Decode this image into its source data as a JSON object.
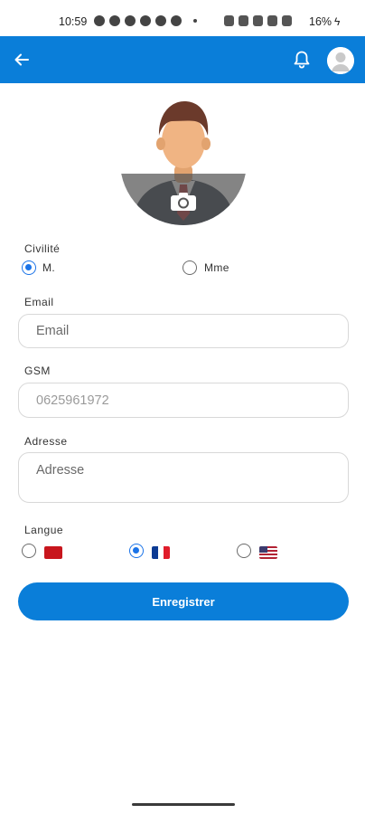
{
  "status_bar": {
    "time": "10:59",
    "battery": "16%",
    "charging_glyph": "ϟ"
  },
  "app_bar": {
    "background_color": "#0a7ed9",
    "back_icon": "arrow-left-icon",
    "notification_icon": "bell-icon",
    "profile_icon": "user-avatar-icon"
  },
  "avatar": {
    "icon": "person-avatar-icon",
    "camera_icon": "camera-icon"
  },
  "form": {
    "civility": {
      "label": "Civilité",
      "options": [
        {
          "label": "M.",
          "checked": true
        },
        {
          "label": "Mme",
          "checked": false
        }
      ]
    },
    "email": {
      "label": "Email",
      "value": "",
      "placeholder": "Email"
    },
    "gsm": {
      "label": "GSM",
      "value": "",
      "placeholder": "0625961972"
    },
    "address": {
      "label": "Adresse",
      "value": "",
      "placeholder": "Adresse"
    },
    "language": {
      "label": "Langue",
      "options": [
        {
          "flag": "morocco-flag-icon",
          "checked": false
        },
        {
          "flag": "france-flag-icon",
          "checked": true
        },
        {
          "flag": "usa-flag-icon",
          "checked": false
        }
      ]
    },
    "save_label": "Enregistrer"
  },
  "colors": {
    "primary": "#0a7ed9",
    "radio_selected": "#1a73e8"
  }
}
